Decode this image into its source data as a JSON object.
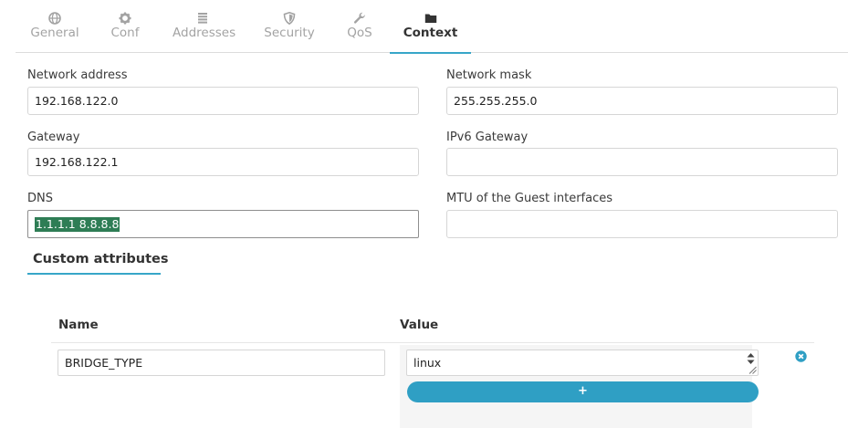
{
  "tabs": [
    {
      "label": "General",
      "icon": "globe-icon"
    },
    {
      "label": "Conf",
      "icon": "gear-icon"
    },
    {
      "label": "Addresses",
      "icon": "list-icon"
    },
    {
      "label": "Security",
      "icon": "shield-icon"
    },
    {
      "label": "QoS",
      "icon": "wrench-icon"
    },
    {
      "label": "Context",
      "icon": "folder-icon",
      "active": true
    }
  ],
  "form": {
    "network_address": {
      "label": "Network address",
      "value": "192.168.122.0"
    },
    "network_mask": {
      "label": "Network mask",
      "value": "255.255.255.0"
    },
    "gateway": {
      "label": "Gateway",
      "value": "192.168.122.1"
    },
    "ipv6_gateway": {
      "label": "IPv6 Gateway",
      "value": ""
    },
    "dns": {
      "label": "DNS",
      "value": "1.1.1.1 8.8.8.8"
    },
    "mtu": {
      "label": "MTU of the Guest interfaces",
      "value": ""
    }
  },
  "custom_attributes": {
    "title": "Custom attributes",
    "headers": {
      "name": "Name",
      "value": "Value"
    },
    "rows": [
      {
        "name": "BRIDGE_TYPE",
        "value": "linux"
      }
    ],
    "add_label": "+"
  },
  "colors": {
    "accent": "#37a6c8",
    "button": "#2f9fc4",
    "selection": "#2e7d55"
  }
}
